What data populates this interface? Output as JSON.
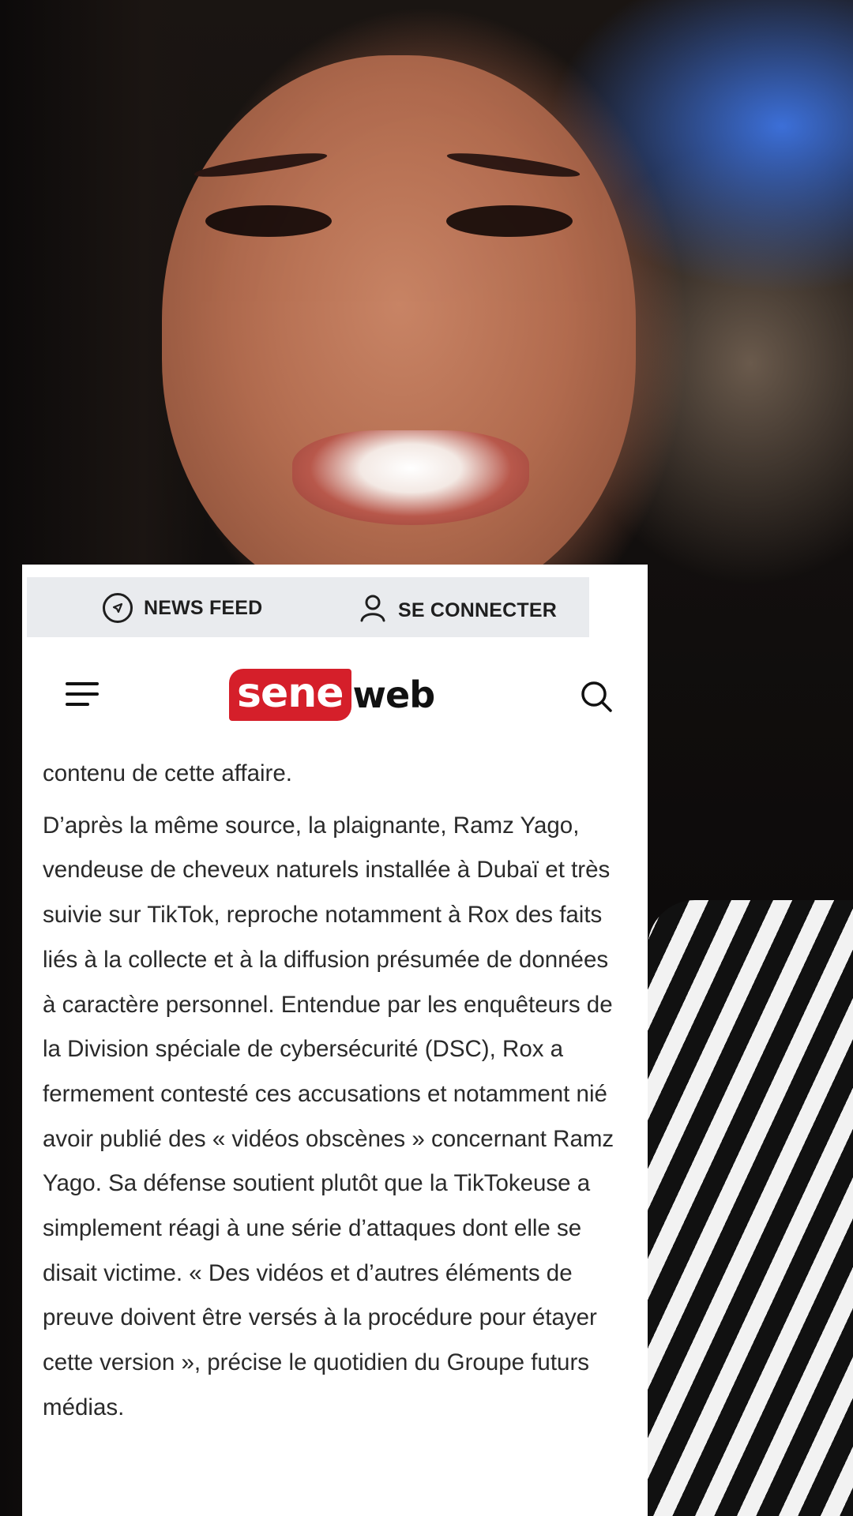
{
  "topbar": {
    "news_feed_label": "NEWS FEED",
    "news_feed_icon": "compass-icon",
    "login_label": "SE CONNECTER",
    "login_icon": "user-icon"
  },
  "header": {
    "menu_icon": "hamburger-menu-icon",
    "logo_part_red": "sene",
    "logo_part_black": "web",
    "search_icon": "search-icon"
  },
  "article": {
    "lead_in": "contenu de cette affaire.",
    "paragraph": "D’après la même source, la plaignante, Ramz Yago, vendeuse de cheveux naturels installée à Dubaï et très suivie sur TikTok, reproche notamment à Rox des faits liés à la collecte et à la diffusion présumée de données à caractère personnel. Entendue par les enquêteurs de la Division spéciale de cybersécurité (DSC), Rox a fermement contesté ces accusations et notamment nié avoir publié des « vidéos obscènes » concernant Ramz Yago. Sa défense soutient plutôt que la TikTokeuse a simplement réagi à une série d’attaques dont elle se disait victime. « Des vidéos et d’autres éléments de preuve doivent être versés à la procédure pour étayer cette version », précise le quotidien du Groupe futurs médias."
  },
  "colors": {
    "brand_red": "#d51f2a",
    "topbar_bg": "#e9ebee",
    "text": "#2a2a2a"
  }
}
